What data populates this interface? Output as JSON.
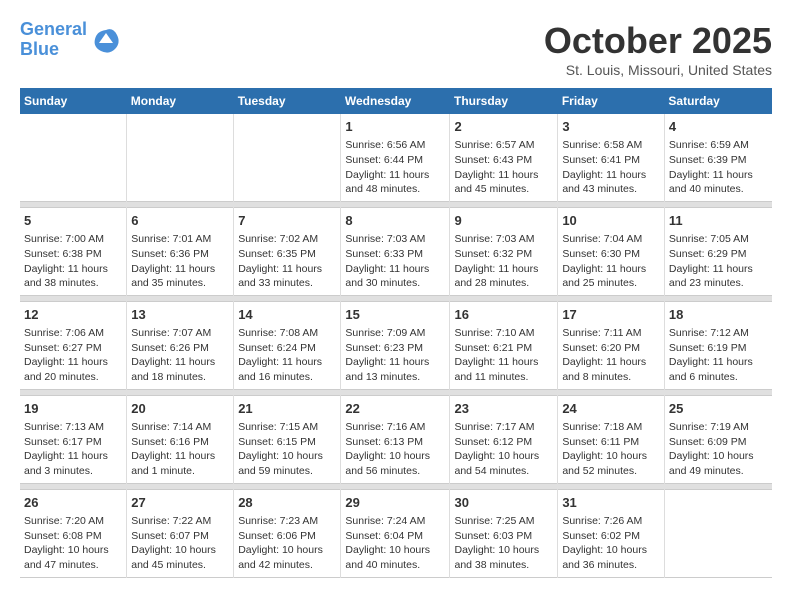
{
  "header": {
    "logo_line1": "General",
    "logo_line2": "Blue",
    "month": "October 2025",
    "location": "St. Louis, Missouri, United States"
  },
  "days_of_week": [
    "Sunday",
    "Monday",
    "Tuesday",
    "Wednesday",
    "Thursday",
    "Friday",
    "Saturday"
  ],
  "weeks": [
    [
      {
        "day": "",
        "info": ""
      },
      {
        "day": "",
        "info": ""
      },
      {
        "day": "",
        "info": ""
      },
      {
        "day": "1",
        "info": "Sunrise: 6:56 AM\nSunset: 6:44 PM\nDaylight: 11 hours\nand 48 minutes."
      },
      {
        "day": "2",
        "info": "Sunrise: 6:57 AM\nSunset: 6:43 PM\nDaylight: 11 hours\nand 45 minutes."
      },
      {
        "day": "3",
        "info": "Sunrise: 6:58 AM\nSunset: 6:41 PM\nDaylight: 11 hours\nand 43 minutes."
      },
      {
        "day": "4",
        "info": "Sunrise: 6:59 AM\nSunset: 6:39 PM\nDaylight: 11 hours\nand 40 minutes."
      }
    ],
    [
      {
        "day": "5",
        "info": "Sunrise: 7:00 AM\nSunset: 6:38 PM\nDaylight: 11 hours\nand 38 minutes."
      },
      {
        "day": "6",
        "info": "Sunrise: 7:01 AM\nSunset: 6:36 PM\nDaylight: 11 hours\nand 35 minutes."
      },
      {
        "day": "7",
        "info": "Sunrise: 7:02 AM\nSunset: 6:35 PM\nDaylight: 11 hours\nand 33 minutes."
      },
      {
        "day": "8",
        "info": "Sunrise: 7:03 AM\nSunset: 6:33 PM\nDaylight: 11 hours\nand 30 minutes."
      },
      {
        "day": "9",
        "info": "Sunrise: 7:03 AM\nSunset: 6:32 PM\nDaylight: 11 hours\nand 28 minutes."
      },
      {
        "day": "10",
        "info": "Sunrise: 7:04 AM\nSunset: 6:30 PM\nDaylight: 11 hours\nand 25 minutes."
      },
      {
        "day": "11",
        "info": "Sunrise: 7:05 AM\nSunset: 6:29 PM\nDaylight: 11 hours\nand 23 minutes."
      }
    ],
    [
      {
        "day": "12",
        "info": "Sunrise: 7:06 AM\nSunset: 6:27 PM\nDaylight: 11 hours\nand 20 minutes."
      },
      {
        "day": "13",
        "info": "Sunrise: 7:07 AM\nSunset: 6:26 PM\nDaylight: 11 hours\nand 18 minutes."
      },
      {
        "day": "14",
        "info": "Sunrise: 7:08 AM\nSunset: 6:24 PM\nDaylight: 11 hours\nand 16 minutes."
      },
      {
        "day": "15",
        "info": "Sunrise: 7:09 AM\nSunset: 6:23 PM\nDaylight: 11 hours\nand 13 minutes."
      },
      {
        "day": "16",
        "info": "Sunrise: 7:10 AM\nSunset: 6:21 PM\nDaylight: 11 hours\nand 11 minutes."
      },
      {
        "day": "17",
        "info": "Sunrise: 7:11 AM\nSunset: 6:20 PM\nDaylight: 11 hours\nand 8 minutes."
      },
      {
        "day": "18",
        "info": "Sunrise: 7:12 AM\nSunset: 6:19 PM\nDaylight: 11 hours\nand 6 minutes."
      }
    ],
    [
      {
        "day": "19",
        "info": "Sunrise: 7:13 AM\nSunset: 6:17 PM\nDaylight: 11 hours\nand 3 minutes."
      },
      {
        "day": "20",
        "info": "Sunrise: 7:14 AM\nSunset: 6:16 PM\nDaylight: 11 hours\nand 1 minute."
      },
      {
        "day": "21",
        "info": "Sunrise: 7:15 AM\nSunset: 6:15 PM\nDaylight: 10 hours\nand 59 minutes."
      },
      {
        "day": "22",
        "info": "Sunrise: 7:16 AM\nSunset: 6:13 PM\nDaylight: 10 hours\nand 56 minutes."
      },
      {
        "day": "23",
        "info": "Sunrise: 7:17 AM\nSunset: 6:12 PM\nDaylight: 10 hours\nand 54 minutes."
      },
      {
        "day": "24",
        "info": "Sunrise: 7:18 AM\nSunset: 6:11 PM\nDaylight: 10 hours\nand 52 minutes."
      },
      {
        "day": "25",
        "info": "Sunrise: 7:19 AM\nSunset: 6:09 PM\nDaylight: 10 hours\nand 49 minutes."
      }
    ],
    [
      {
        "day": "26",
        "info": "Sunrise: 7:20 AM\nSunset: 6:08 PM\nDaylight: 10 hours\nand 47 minutes."
      },
      {
        "day": "27",
        "info": "Sunrise: 7:22 AM\nSunset: 6:07 PM\nDaylight: 10 hours\nand 45 minutes."
      },
      {
        "day": "28",
        "info": "Sunrise: 7:23 AM\nSunset: 6:06 PM\nDaylight: 10 hours\nand 42 minutes."
      },
      {
        "day": "29",
        "info": "Sunrise: 7:24 AM\nSunset: 6:04 PM\nDaylight: 10 hours\nand 40 minutes."
      },
      {
        "day": "30",
        "info": "Sunrise: 7:25 AM\nSunset: 6:03 PM\nDaylight: 10 hours\nand 38 minutes."
      },
      {
        "day": "31",
        "info": "Sunrise: 7:26 AM\nSunset: 6:02 PM\nDaylight: 10 hours\nand 36 minutes."
      },
      {
        "day": "",
        "info": ""
      }
    ]
  ]
}
